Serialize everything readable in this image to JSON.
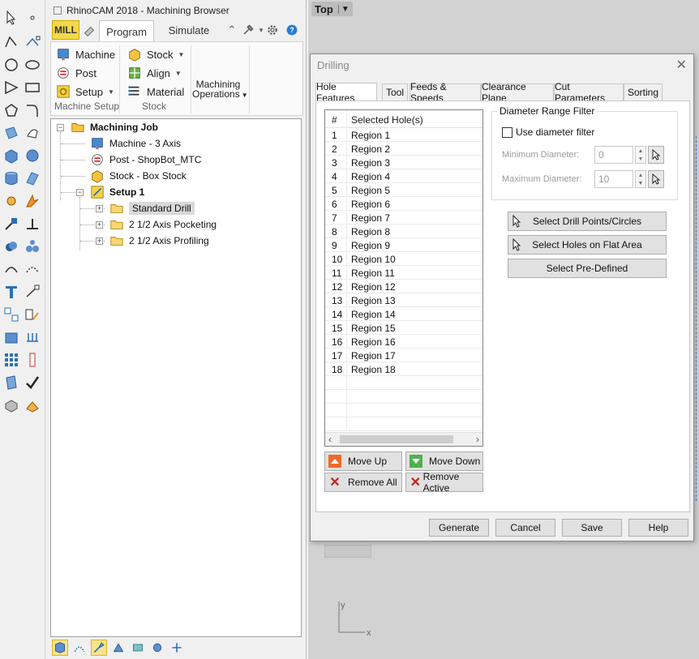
{
  "browser": {
    "title": "RhinoCAM 2018 - Machining Browser",
    "tabs": {
      "mill": "MILL",
      "program": "Program",
      "simulate": "Simulate"
    },
    "ribbon": {
      "machine": "Machine",
      "post": "Post",
      "setup": "Setup",
      "stock": "Stock",
      "align": "Align",
      "material": "Material",
      "machining_ops_1": "Machining",
      "machining_ops_2": "Operations",
      "group_machine_setup": "Machine Setup",
      "group_stock": "Stock"
    },
    "tree": {
      "root": "Machining Job",
      "machine": "Machine - 3 Axis",
      "post": "Post - ShopBot_MTC",
      "stock": "Stock - Box Stock",
      "setup": "Setup 1",
      "ops": [
        "Standard Drill",
        "2 1/2 Axis Pocketing",
        "2 1/2 Axis Profiling"
      ]
    }
  },
  "viewport": {
    "view_name": "Top",
    "axis_y": "y",
    "axis_x": "x"
  },
  "dialog": {
    "title": "Drilling",
    "tabs": [
      "Hole Features",
      "Tool",
      "Feeds & Speeds",
      "Clearance Plane",
      "Cut Parameters",
      "Sorting"
    ],
    "list": {
      "col_num": "#",
      "col_holes": "Selected Hole(s)",
      "rows": [
        {
          "n": "1",
          "r": "Region 1"
        },
        {
          "n": "2",
          "r": "Region 2"
        },
        {
          "n": "3",
          "r": "Region 3"
        },
        {
          "n": "4",
          "r": "Region 4"
        },
        {
          "n": "5",
          "r": "Region 5"
        },
        {
          "n": "6",
          "r": "Region 6"
        },
        {
          "n": "7",
          "r": "Region 7"
        },
        {
          "n": "8",
          "r": "Region 8"
        },
        {
          "n": "9",
          "r": "Region 9"
        },
        {
          "n": "10",
          "r": "Region 10"
        },
        {
          "n": "11",
          "r": "Region 11"
        },
        {
          "n": "12",
          "r": "Region 12"
        },
        {
          "n": "13",
          "r": "Region 13"
        },
        {
          "n": "14",
          "r": "Region 14"
        },
        {
          "n": "15",
          "r": "Region 15"
        },
        {
          "n": "16",
          "r": "Region 16"
        },
        {
          "n": "17",
          "r": "Region 17"
        },
        {
          "n": "18",
          "r": "Region 18"
        }
      ]
    },
    "list_buttons": {
      "move_up": "Move Up",
      "move_down": "Move Down",
      "remove_all": "Remove All",
      "remove_active": "Remove Active"
    },
    "diameter_filter": {
      "legend": "Diameter Range Filter",
      "use_label": "Use diameter filter",
      "min_label": "Minimum Diameter:",
      "min_value": "0",
      "max_label": "Maximum Diameter:",
      "max_value": "10"
    },
    "select_buttons": {
      "drill_points": "Select Drill Points/Circles",
      "flat_area": "Select Holes on Flat Area",
      "pre_defined": "Select Pre-Defined"
    },
    "footer": {
      "generate": "Generate",
      "cancel": "Cancel",
      "save": "Save",
      "help": "Help"
    }
  },
  "colors": {
    "mill_tab": "#f5d84a",
    "folder": "#f6c343",
    "accent_blue": "#2b6fb6"
  }
}
